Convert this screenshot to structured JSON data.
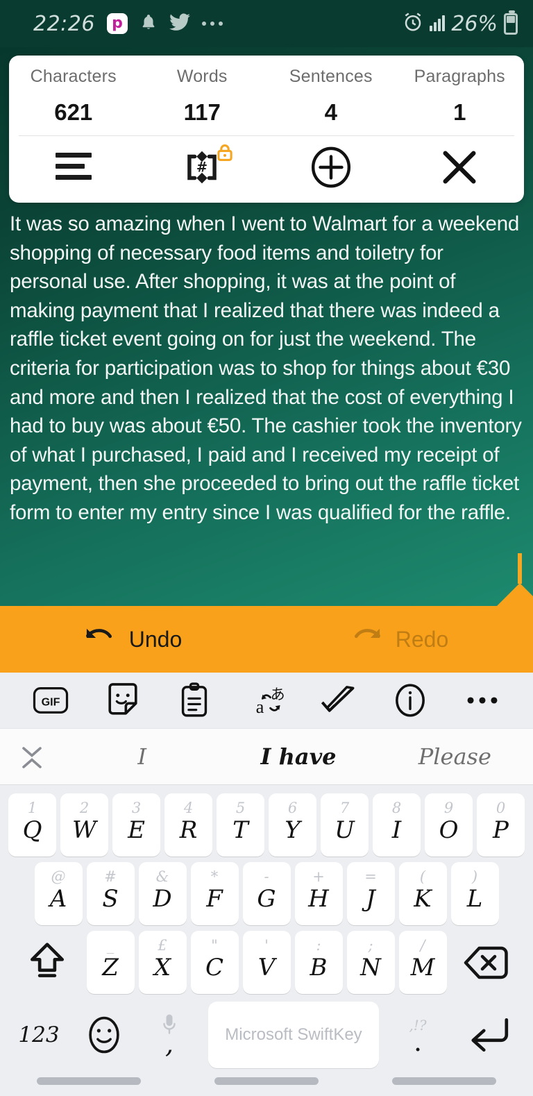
{
  "status_bar": {
    "time": "22:26",
    "app_icon_label": "p",
    "icons": [
      "pinterest-icon",
      "bell-icon",
      "twitter-icon",
      "overflow-dots-icon",
      "alarm-icon",
      "signal-icon",
      "battery-icon"
    ],
    "battery_percent": "26%"
  },
  "stats_card": {
    "metrics": [
      {
        "label": "Characters",
        "value": "621"
      },
      {
        "label": "Words",
        "value": "117"
      },
      {
        "label": "Sentences",
        "value": "4"
      },
      {
        "label": "Paragraphs",
        "value": "1"
      }
    ],
    "actions": [
      {
        "name": "menu-lines-icon",
        "label": "Menu"
      },
      {
        "name": "hashtag-clipboard-icon",
        "label": "Tags",
        "badge": "lock-icon",
        "badge_color": "#f5a623"
      },
      {
        "name": "plus-circle-icon",
        "label": "Add"
      },
      {
        "name": "close-x-icon",
        "label": "Close"
      }
    ]
  },
  "editor": {
    "body_text": "It was so amazing when I went to Walmart for a weekend shopping of necessary food items and toiletry for personal use. After shopping, it was at the point of making payment that I realized that there was indeed a raffle ticket event going on for just the weekend. The criteria for participation was to shop for things about €30 and more and then I realized that the cost of everything I had to buy was about €50. The cashier took the inventory of what I purchased, I paid and I received my receipt of payment, then she proceeded to bring out the raffle ticket form to enter my entry since I was qualified for the raffle.",
    "caret_color": "#f5a623",
    "background_top": "#07382d",
    "background_bottom": "#1d8a6e"
  },
  "undo_bar": {
    "background": "#f9a11b",
    "undo_label": "Undo",
    "redo_label": "Redo",
    "undo_enabled": "true",
    "redo_enabled": "false"
  },
  "keyboard": {
    "toolbar_icons": [
      "gif-icon",
      "sticker-icon",
      "clipboard-icon",
      "translate-icon",
      "spellcheck-icon",
      "info-icon",
      "more-dots-icon"
    ],
    "gif_label": "GIF",
    "predictions": [
      "I",
      "I have",
      "Please"
    ],
    "rows": [
      {
        "keys": [
          {
            "main": "Q",
            "hint": "1"
          },
          {
            "main": "W",
            "hint": "2"
          },
          {
            "main": "E",
            "hint": "3"
          },
          {
            "main": "R",
            "hint": "4"
          },
          {
            "main": "T",
            "hint": "5"
          },
          {
            "main": "Y",
            "hint": "6"
          },
          {
            "main": "U",
            "hint": "7"
          },
          {
            "main": "I",
            "hint": "8"
          },
          {
            "main": "O",
            "hint": "9"
          },
          {
            "main": "P",
            "hint": "0"
          }
        ]
      },
      {
        "keys": [
          {
            "main": "A",
            "hint": "@"
          },
          {
            "main": "S",
            "hint": "#"
          },
          {
            "main": "D",
            "hint": "&"
          },
          {
            "main": "F",
            "hint": "*"
          },
          {
            "main": "G",
            "hint": "-"
          },
          {
            "main": "H",
            "hint": "+"
          },
          {
            "main": "J",
            "hint": "="
          },
          {
            "main": "K",
            "hint": "("
          },
          {
            "main": "L",
            "hint": ")"
          }
        ]
      },
      {
        "keys": [
          {
            "main": "Z",
            "hint": "_"
          },
          {
            "main": "X",
            "hint": "£"
          },
          {
            "main": "C",
            "hint": "\""
          },
          {
            "main": "V",
            "hint": "'"
          },
          {
            "main": "B",
            "hint": ":"
          },
          {
            "main": "N",
            "hint": ";"
          },
          {
            "main": "M",
            "hint": "/"
          }
        ]
      }
    ],
    "shift_icon": "shift-arrow-icon",
    "backspace_icon": "backspace-icon",
    "numeric_label": "123",
    "emoji_icon": "emoji-face-icon",
    "comma_label": ",",
    "mic_hint_icon": "microphone-icon",
    "space_label": "Microsoft SwiftKey",
    "period_label": ".",
    "period_hint": ",!?",
    "enter_icon": "enter-arrow-icon"
  }
}
